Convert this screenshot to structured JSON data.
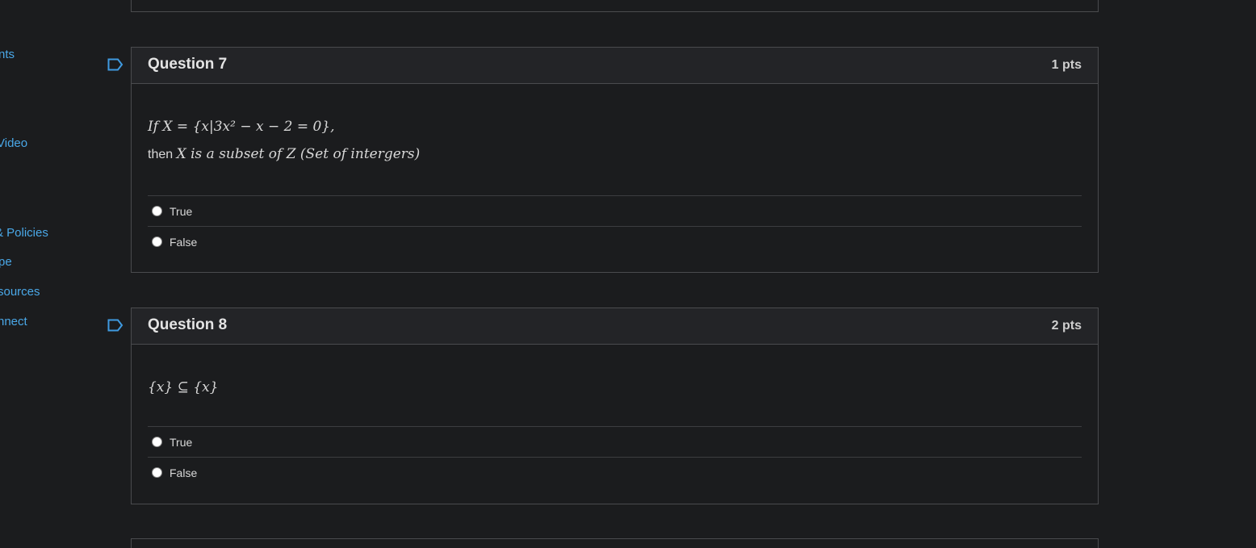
{
  "nav": {
    "items": [
      "nts",
      "Video",
      "& Policies",
      "pe",
      "sources",
      "nnect"
    ]
  },
  "questions": [
    {
      "title": "Question 7",
      "points": "1 pts",
      "line1": "If X = {x|3x² − x − 2 = 0},",
      "line2_prefix": "then",
      "line2_math": "X is a subset of Z (Set of intergers)",
      "answers": [
        "True",
        "False"
      ]
    },
    {
      "title": "Question 8",
      "points": "2 pts",
      "line1": "{x} ⊆ {x}",
      "answers": [
        "True",
        "False"
      ]
    }
  ],
  "colors": {
    "background": "#1b1c1e",
    "link": "#4aa8e8",
    "header_bg": "#232427",
    "border": "#4a4b4e"
  },
  "icons": [
    "flag-icon",
    "radio-icon"
  ]
}
